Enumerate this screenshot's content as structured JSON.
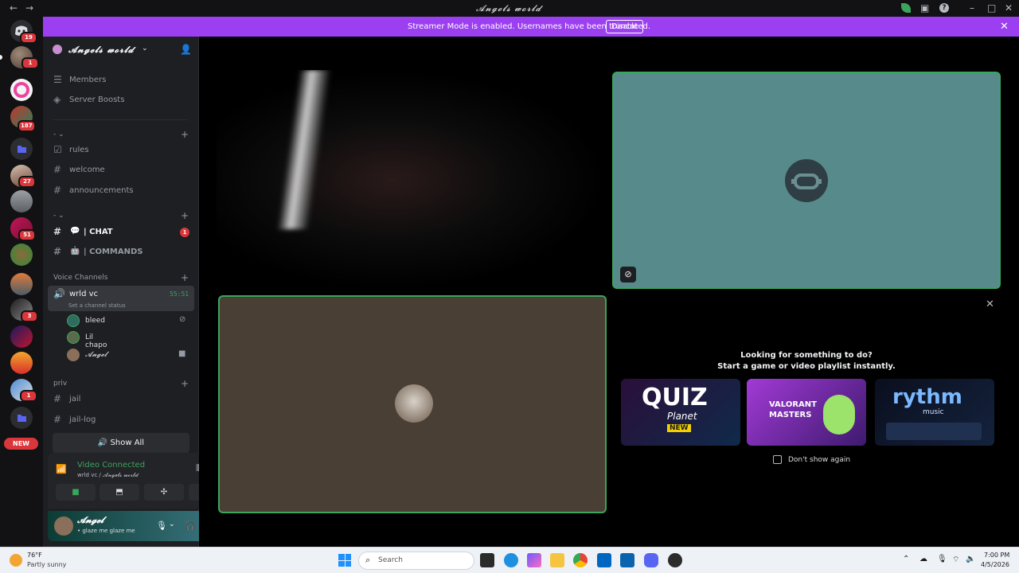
{
  "window": {
    "title": "𝓐𝓷𝓰𝓮𝓵𝓼 𝔀𝓸𝓻𝓵𝓭"
  },
  "rail": {
    "badges": [
      "19",
      "1",
      "187",
      "27",
      "51",
      "3",
      "1"
    ],
    "new_label": "NEW"
  },
  "banner": {
    "text": "Streamer Mode is enabled. Usernames have been truncated.",
    "disable_label": "Disable"
  },
  "server": {
    "name": "𝓐𝓷𝓰𝓮𝓵𝓼 𝔀𝓸𝓻𝓵𝓭"
  },
  "sidebar": {
    "members": "Members",
    "boosts": "Server Boosts",
    "channels_a": [
      "rules",
      "welcome",
      "announcements"
    ],
    "chat": "| CHAT",
    "chat_badge": "1",
    "commands": "| COMMANDS",
    "voice_category": "Voice Channels",
    "voice_channel": "wrld vc",
    "voice_timer": "55:51",
    "voice_status": "Set a channel status",
    "voice_users": [
      "bleed",
      "Lil chapo",
      "𝓐𝓷𝓰𝓮𝓵"
    ],
    "priv_category": "priv",
    "priv_channels": [
      "jail",
      "jail-log"
    ],
    "show_all": "Show All"
  },
  "vc_panel": {
    "status": "Video Connected",
    "location": "wrld vc / 𝓐𝓷𝓰𝓮𝓵𝓼 𝔀𝓸𝓻𝓵𝓭"
  },
  "user_panel": {
    "name": "𝓐𝓷𝓰𝓮𝓵",
    "status": "• glaze me glaze me"
  },
  "activity": {
    "line1": "Looking for something to do?",
    "line2": "Start a game or video playlist instantly.",
    "cards": [
      "QUIZ",
      "Planet",
      "NEW",
      "VALORANT",
      "MASTERS",
      "rythm",
      "music"
    ],
    "dont_show": "Don't show again"
  },
  "taskbar": {
    "temp": "76°F",
    "weather": "Partly sunny",
    "search_placeholder": "Search",
    "time": "7:00 PM",
    "date": "4/5/2026"
  },
  "colors": {
    "brand": "#9b3ff0",
    "connected": "#3ba55c",
    "badge": "#da373c"
  }
}
